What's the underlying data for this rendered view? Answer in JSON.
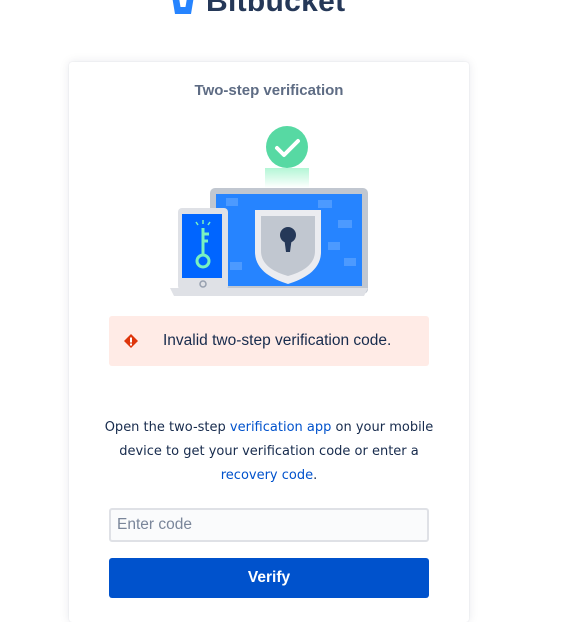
{
  "brand": {
    "name": "Bitbucket",
    "logo_icon": "bitbucket-logo-icon",
    "color": "#2684ff"
  },
  "card": {
    "title": "Two-step verification",
    "illustration_icon": "laptop-phone-key-lock-checkmark-icon"
  },
  "error": {
    "icon": "warning-diamond-icon",
    "message": "Invalid two-step verification code.",
    "background": "#ffebe6",
    "icon_color": "#de350b"
  },
  "instructions": {
    "text_before": "Open the two-step ",
    "link_app": "verification app",
    "text_middle": " on your mobile device to get your verification code or enter a ",
    "link_recovery": "recovery code",
    "text_after": "."
  },
  "form": {
    "code_placeholder": "Enter code",
    "code_value": "",
    "verify_label": "Verify",
    "accent": "#0052cc"
  }
}
